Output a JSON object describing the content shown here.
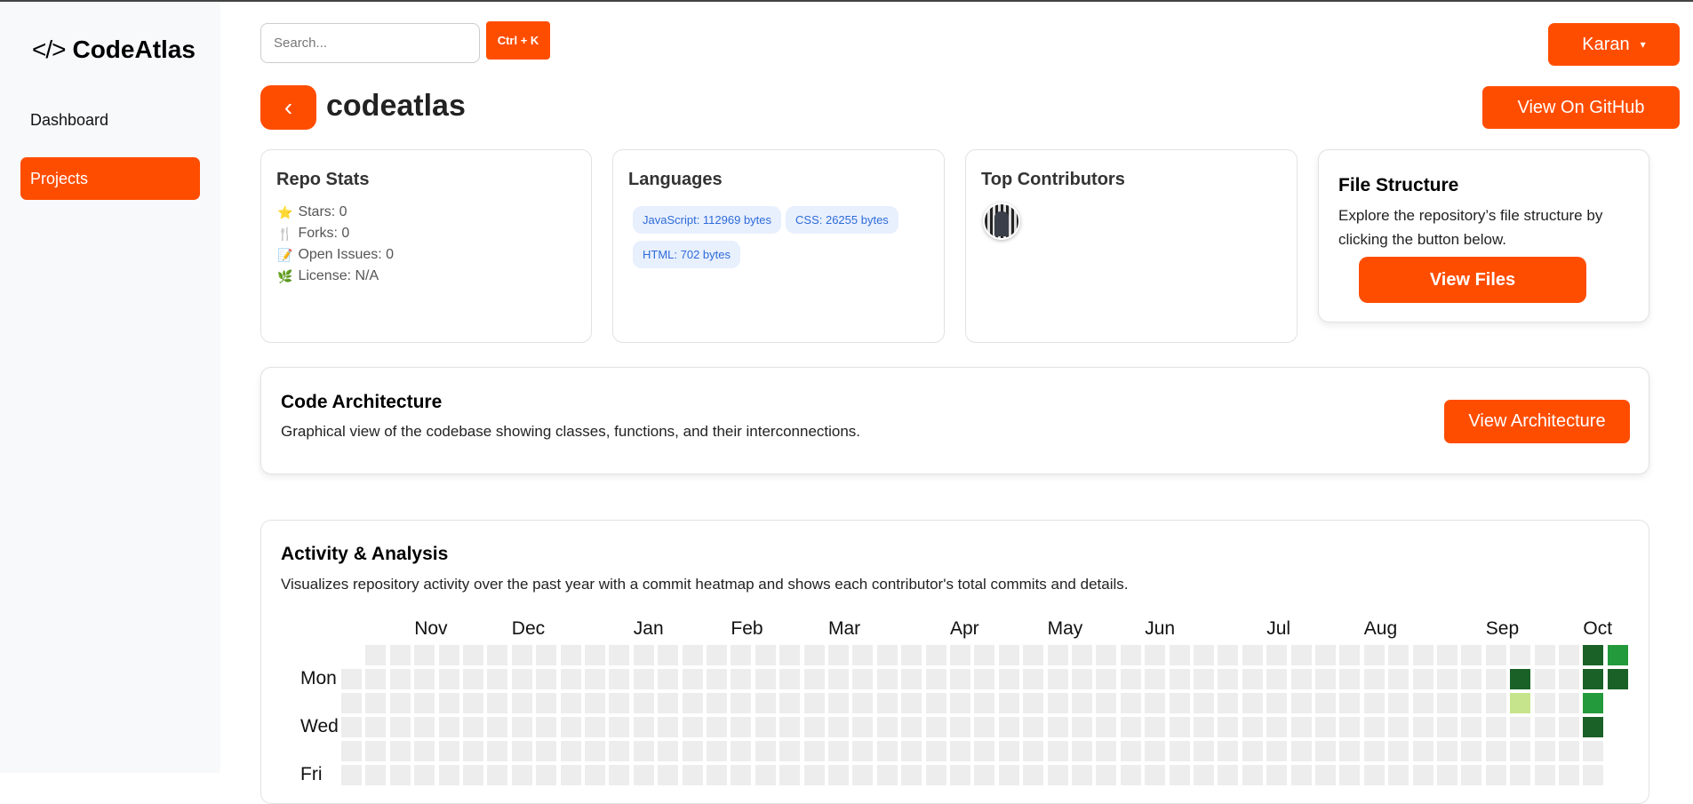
{
  "brand": {
    "name": "CodeAtlas",
    "icon": "code-brackets-icon"
  },
  "sidebar": {
    "items": [
      {
        "label": "Dashboard",
        "active": false
      },
      {
        "label": "Projects",
        "active": true
      }
    ]
  },
  "topbar": {
    "search_placeholder": "Search...",
    "shortcut_label": "Ctrl + K",
    "user_label": "Karan",
    "user_caret": "▾"
  },
  "repo": {
    "name": "codeatlas",
    "back_icon": "‹",
    "github_label": "View On GitHub"
  },
  "repo_stats": {
    "title": "Repo Stats",
    "items": [
      {
        "icon": "⭐",
        "label": "Stars: 0"
      },
      {
        "icon": "🍴",
        "label": "Forks: 0"
      },
      {
        "icon": "📝",
        "label": "Open Issues: 0"
      },
      {
        "icon": "🌿",
        "label": "License: N/A"
      }
    ]
  },
  "languages": {
    "title": "Languages",
    "items": [
      "JavaScript: 112969 bytes",
      "CSS: 26255 bytes",
      "HTML: 702 bytes"
    ]
  },
  "contributors": {
    "title": "Top Contributors"
  },
  "file_structure": {
    "title": "File Structure",
    "description": "Explore the repository’s file structure by clicking the button below.",
    "button": "View Files"
  },
  "architecture": {
    "title": "Code Architecture",
    "description": "Graphical view of the codebase showing classes, functions, and their interconnections.",
    "button": "View Architecture"
  },
  "activity": {
    "title": "Activity & Analysis",
    "description": "Visualizes repository activity over the past year with a commit heatmap and shows each contributor's total commits and details."
  },
  "chart_data": {
    "type": "heatmap",
    "weeks": 53,
    "months": [
      {
        "label": "Nov",
        "week": 3
      },
      {
        "label": "Dec",
        "week": 7
      },
      {
        "label": "Jan",
        "week": 12
      },
      {
        "label": "Feb",
        "week": 16
      },
      {
        "label": "Mar",
        "week": 20
      },
      {
        "label": "Apr",
        "week": 25
      },
      {
        "label": "May",
        "week": 29
      },
      {
        "label": "Jun",
        "week": 33
      },
      {
        "label": "Jul",
        "week": 38
      },
      {
        "label": "Aug",
        "week": 42
      },
      {
        "label": "Sep",
        "week": 47
      },
      {
        "label": "Oct",
        "week": 51
      }
    ],
    "day_labels": [
      {
        "label": "Mon",
        "day": 1
      },
      {
        "label": "Wed",
        "day": 3
      },
      {
        "label": "Fri",
        "day": 5
      }
    ],
    "first_week_start_day": 1,
    "last_week_days": 2,
    "active": [
      {
        "week": 48,
        "day": 1,
        "level": 4
      },
      {
        "week": 48,
        "day": 2,
        "level": 1
      },
      {
        "week": 51,
        "day": 0,
        "level": 4
      },
      {
        "week": 51,
        "day": 1,
        "level": 4
      },
      {
        "week": 51,
        "day": 2,
        "level": 3
      },
      {
        "week": 51,
        "day": 3,
        "level": 4
      },
      {
        "week": 52,
        "day": 0,
        "level": 3
      },
      {
        "week": 52,
        "day": 1,
        "level": 4
      }
    ],
    "level_colors": [
      "#ededed",
      "#c6e48b",
      "#7bc96f",
      "#239a3b",
      "#196127"
    ]
  }
}
